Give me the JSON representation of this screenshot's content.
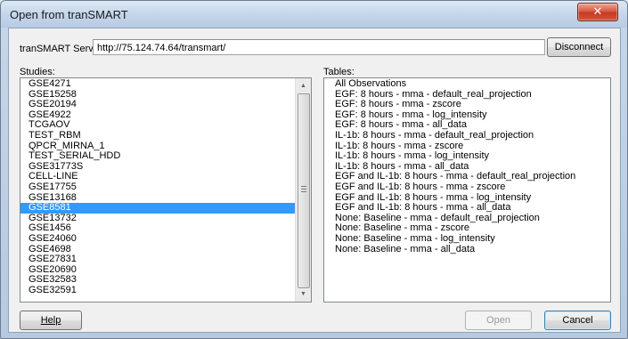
{
  "window": {
    "title": "Open from tranSMART",
    "close_glyph": "✕"
  },
  "server": {
    "label": "tranSMART Server:",
    "url": "http://75.124.74.64/transmart/",
    "disconnect_label": "Disconnect"
  },
  "studies": {
    "label": "Studies:",
    "selected_index": 12,
    "items": [
      "GSE4271",
      "GSE15258",
      "GSE20194",
      "GSE4922",
      "TCGAOV",
      "TEST_RBM",
      "QPCR_MIRNA_1",
      "TEST_SERIAL_HDD",
      "GSE31773S",
      "CELL-LINE",
      "GSE17755",
      "GSE13168",
      "GSE8581",
      "GSE13732",
      "GSE1456",
      "GSE24060",
      "GSE4698",
      "GSE27831",
      "GSE20690",
      "GSE32583",
      "GSE32591"
    ]
  },
  "tables": {
    "label": "Tables:",
    "items": [
      "All Observations",
      "EGF: 8 hours - mma - default_real_projection",
      "EGF: 8 hours - mma - zscore",
      "EGF: 8 hours - mma - log_intensity",
      "EGF: 8 hours - mma - all_data",
      "IL-1b: 8 hours - mma - default_real_projection",
      "IL-1b: 8 hours - mma - zscore",
      "IL-1b: 8 hours - mma - log_intensity",
      "IL-1b: 8 hours - mma - all_data",
      "EGF and IL-1b: 8 hours - mma - default_real_projection",
      "EGF and IL-1b: 8 hours - mma - zscore",
      "EGF and IL-1b: 8 hours - mma - log_intensity",
      "EGF and IL-1b: 8 hours - mma - all_data",
      "None: Baseline - mma - default_real_projection",
      "None: Baseline - mma - zscore",
      "None: Baseline - mma - log_intensity",
      "None: Baseline - mma - all_data"
    ]
  },
  "buttons": {
    "help": "Help",
    "open": "Open",
    "cancel": "Cancel"
  },
  "icons": {
    "scroll_up": "scroll-up-arrow-icon",
    "scroll_down": "scroll-down-arrow-icon"
  },
  "colors": {
    "selection": "#3399ff",
    "close_button": "#c9432a"
  }
}
